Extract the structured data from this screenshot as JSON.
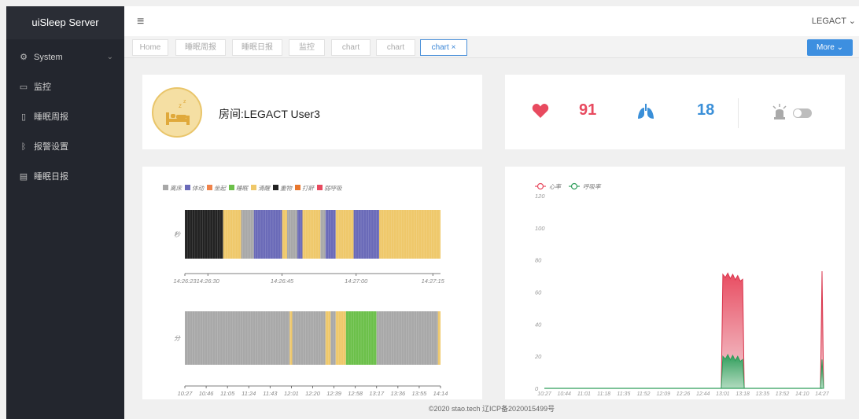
{
  "sidebar": {
    "title": "uiSleep Server",
    "items": [
      {
        "label": "System",
        "icon": "gear-icon"
      },
      {
        "label": "监控",
        "icon": "monitor-icon"
      },
      {
        "label": "睡眠周报",
        "icon": "document-icon"
      },
      {
        "label": "报警设置",
        "icon": "bluetooth-icon"
      },
      {
        "label": "睡眠日报",
        "icon": "report-icon"
      }
    ]
  },
  "header": {
    "user": "LEGACT"
  },
  "tabs": {
    "items": [
      {
        "label": "Home"
      },
      {
        "label": "睡眠周报"
      },
      {
        "label": "睡眠日报"
      },
      {
        "label": "监控"
      },
      {
        "label": "chart"
      },
      {
        "label": "chart"
      },
      {
        "label": "chart ×",
        "active": true
      }
    ],
    "more": "More ⌄"
  },
  "room": {
    "label": "房间:LEGACT  User3"
  },
  "vitals": {
    "heart_rate": "91",
    "breath_rate": "18",
    "colors": {
      "heart": "#e84a5f",
      "lung": "#3a8fd8"
    }
  },
  "chart_data": [
    {
      "type": "bar",
      "legend": [
        "离床",
        "体动",
        "坐起",
        "睡眠",
        "清醒",
        "重物",
        "打鼾",
        "弱呼吸"
      ],
      "legend_colors": [
        "#a8a8a8",
        "#6a6ab8",
        "#f0834a",
        "#6cc04a",
        "#efc86a",
        "#222222",
        "#e8772e",
        "#e84a5f"
      ],
      "rows": [
        {
          "ylabel": "秒",
          "x_ticks": [
            "14:26:23",
            "14:26:30",
            "14:26:45",
            "14:27:00",
            "14:27:15"
          ],
          "segments": [
            {
              "state": "重物",
              "from": 0.0,
              "to": 0.15
            },
            {
              "state": "清醒",
              "from": 0.15,
              "to": 0.22
            },
            {
              "state": "离床",
              "from": 0.22,
              "to": 0.27
            },
            {
              "state": "体动",
              "from": 0.27,
              "to": 0.38
            },
            {
              "state": "清醒",
              "from": 0.38,
              "to": 0.4
            },
            {
              "state": "离床",
              "from": 0.4,
              "to": 0.44
            },
            {
              "state": "体动",
              "from": 0.44,
              "to": 0.46
            },
            {
              "state": "清醒",
              "from": 0.46,
              "to": 0.53
            },
            {
              "state": "离床",
              "from": 0.53,
              "to": 0.55
            },
            {
              "state": "体动",
              "from": 0.55,
              "to": 0.59
            },
            {
              "state": "清醒",
              "from": 0.59,
              "to": 0.66
            },
            {
              "state": "体动",
              "from": 0.66,
              "to": 0.76
            },
            {
              "state": "清醒",
              "from": 0.76,
              "to": 1.0
            }
          ]
        },
        {
          "ylabel": "分",
          "x_ticks": [
            "10:27",
            "10:46",
            "11:05",
            "11:24",
            "11:43",
            "12:01",
            "12:20",
            "12:39",
            "12:58",
            "13:17",
            "13:36",
            "13:55",
            "14:14"
          ],
          "segments": [
            {
              "state": "离床",
              "from": 0.0,
              "to": 0.41
            },
            {
              "state": "清醒",
              "from": 0.41,
              "to": 0.42
            },
            {
              "state": "离床",
              "from": 0.42,
              "to": 0.55
            },
            {
              "state": "清醒",
              "from": 0.55,
              "to": 0.57
            },
            {
              "state": "离床",
              "from": 0.57,
              "to": 0.59
            },
            {
              "state": "清醒",
              "from": 0.59,
              "to": 0.63
            },
            {
              "state": "睡眠",
              "from": 0.63,
              "to": 0.75
            },
            {
              "state": "离床",
              "from": 0.75,
              "to": 0.99
            },
            {
              "state": "清醒",
              "from": 0.99,
              "to": 1.0
            }
          ]
        }
      ]
    },
    {
      "type": "area",
      "series": [
        {
          "name": "心率",
          "color": "#e84a5f"
        },
        {
          "name": "呼吸率",
          "color": "#2e9d5a"
        }
      ],
      "ylim": [
        0,
        120
      ],
      "y_ticks": [
        "0",
        "20",
        "40",
        "60",
        "80",
        "100",
        "120"
      ],
      "x": [
        "10:27",
        "10:44",
        "11:01",
        "11:18",
        "11:35",
        "11:52",
        "12:09",
        "12:26",
        "12:44",
        "13:01",
        "13:18",
        "13:35",
        "13:52",
        "14:10",
        "14:27"
      ],
      "heart_rate_values": [
        0,
        0,
        0,
        0,
        0,
        0,
        0,
        0,
        0,
        71,
        68,
        0,
        0,
        0,
        73
      ],
      "breath_rate_values": [
        0,
        0,
        0,
        0,
        0,
        0,
        0,
        0,
        0,
        20,
        18,
        0,
        0,
        0,
        18
      ]
    }
  ],
  "footer": {
    "text": "©2020 stao.tech  辽ICP备2020015499号"
  }
}
